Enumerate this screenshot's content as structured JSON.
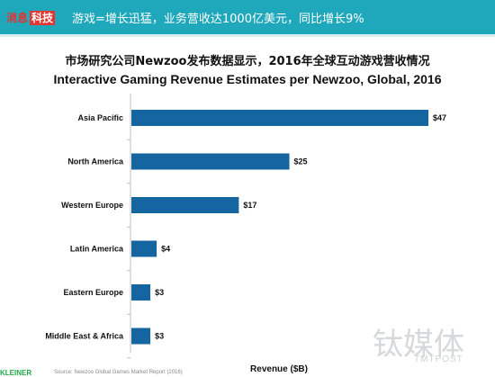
{
  "header": {
    "brand_a": "消息",
    "brand_b": "科技",
    "title": "游戏=增长迅猛，业务营收达1000亿美元，同比增长9%"
  },
  "colors": {
    "header_bg": "#1fa7bb",
    "bar": "#1565a0"
  },
  "chart_data": {
    "type": "bar",
    "orientation": "horizontal",
    "title": "市场研究公司Newzoo发布数据显示，2016年全球互动游戏营收情况",
    "subtitle": "Interactive Gaming Revenue Estimates per Newzoo, Global, 2016",
    "xlabel": "Revenue ($B)",
    "ylabel": "",
    "categories": [
      "Asia Pacific",
      "North America",
      "Western Europe",
      "Latin America",
      "Eastern Europe",
      "Middle East & Africa"
    ],
    "values": [
      47,
      25,
      17,
      4,
      3,
      3
    ],
    "value_labels": [
      "$47",
      "$25",
      "$17",
      "$4",
      "$3",
      "$3"
    ],
    "xlim": [
      0,
      47
    ],
    "grid": false
  },
  "footer": {
    "logo": "KLEINER",
    "source": "Source: Newzoo Global Games Market Report (2016)"
  },
  "watermark": {
    "main": "钛媒体",
    "sub": "TMTPOST"
  }
}
